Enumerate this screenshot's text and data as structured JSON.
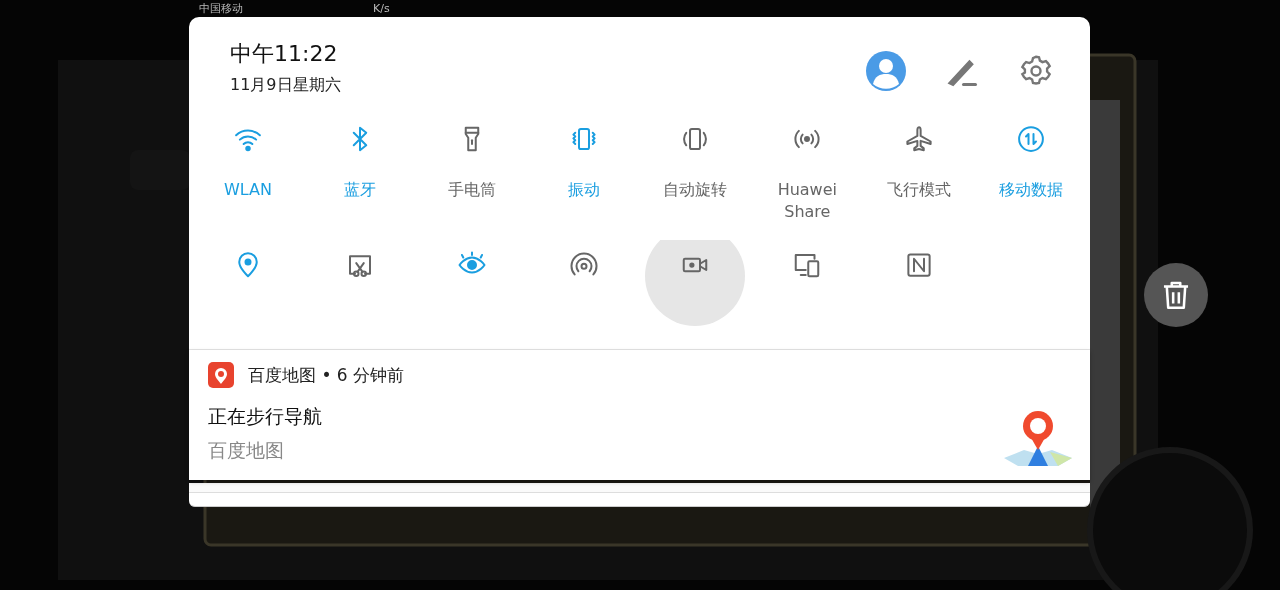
{
  "status_bar": {
    "carrier": "中国移动",
    "speed_unit": "K/s"
  },
  "header": {
    "time": "中午11:22",
    "date": "11月9日星期六"
  },
  "toggles": [
    {
      "label": "WLAN",
      "on": true
    },
    {
      "label": "蓝牙",
      "on": true
    },
    {
      "label": "手电筒",
      "on": false
    },
    {
      "label": "振动",
      "on": true
    },
    {
      "label": "自动旋转",
      "on": false
    },
    {
      "label": "Huawei Share",
      "on": false
    },
    {
      "label": "飞行模式",
      "on": false
    },
    {
      "label": "移动数据",
      "on": true
    }
  ],
  "toggles_row_2": [
    {
      "on": true,
      "pressed": false
    },
    {
      "on": false,
      "pressed": false
    },
    {
      "on": true,
      "pressed": false
    },
    {
      "on": false,
      "pressed": false
    },
    {
      "on": false,
      "pressed": true
    },
    {
      "on": false,
      "pressed": false
    },
    {
      "on": false,
      "pressed": false
    }
  ],
  "notification": {
    "app": "百度地图",
    "separator": "•",
    "time": "6 分钟前",
    "title": "正在步行导航",
    "text": "百度地图"
  }
}
